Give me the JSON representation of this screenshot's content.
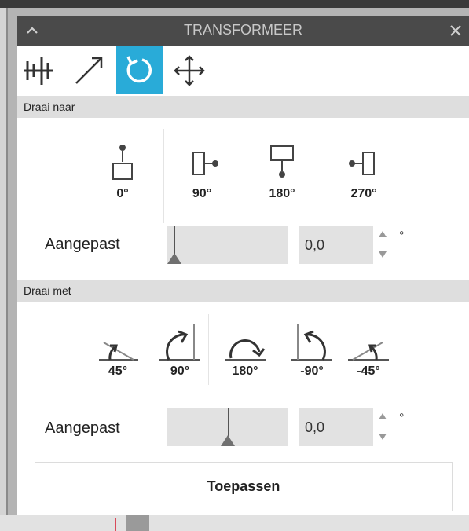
{
  "panel": {
    "title": "TRANSFORMEER",
    "tools": [
      {
        "name": "align-icon",
        "active": false
      },
      {
        "name": "scale-icon",
        "active": false
      },
      {
        "name": "rotate-icon",
        "active": true
      },
      {
        "name": "move-icon",
        "active": false
      }
    ],
    "accent_color": "#29abd8"
  },
  "rotate_to": {
    "header": "Draai naar",
    "options": [
      {
        "label": "0°",
        "icon": "rotate-to-0-icon"
      },
      {
        "label": "90°",
        "icon": "rotate-to-90-icon"
      },
      {
        "label": "180°",
        "icon": "rotate-to-180-icon"
      },
      {
        "label": "270°",
        "icon": "rotate-to-270-icon"
      }
    ],
    "custom_label": "Aangepast",
    "custom_value": "0,0",
    "slider_level": 0.0,
    "unit": "°"
  },
  "rotate_by": {
    "header": "Draai met",
    "options": [
      {
        "label": "45°",
        "icon": "rotate-by-45-icon"
      },
      {
        "label": "90°",
        "icon": "rotate-by-90-icon"
      },
      {
        "label": "180°",
        "icon": "rotate-by-180-icon"
      },
      {
        "label": "-90°",
        "icon": "rotate-by-minus-90-icon"
      },
      {
        "label": "-45°",
        "icon": "rotate-by-minus-45-icon"
      }
    ],
    "custom_label": "Aangepast",
    "custom_value": "0,0",
    "slider_level": 0.5,
    "unit": "°"
  },
  "apply_label": "Toepassen"
}
